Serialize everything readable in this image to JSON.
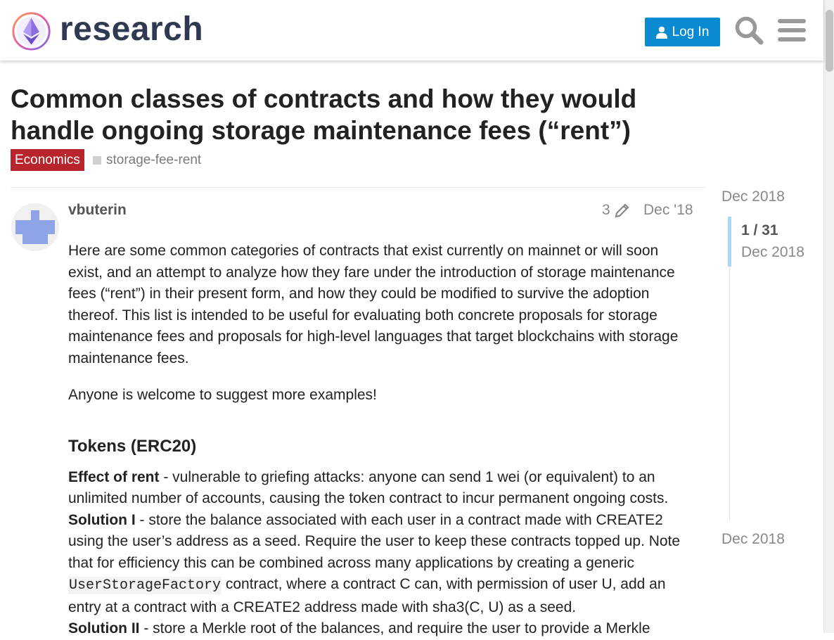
{
  "header": {
    "logo_text": "research",
    "login_label": "Log In",
    "icons": [
      "search-icon",
      "hamburger-menu-icon",
      "user-icon"
    ]
  },
  "topic": {
    "title": "Common classes of contracts and how they would handle ongoing storage maintenance fees (“rent”)",
    "category": "Economics",
    "category_color": "#b8242b",
    "tag": "storage-fee-rent"
  },
  "post": {
    "username": "vbuterin",
    "edit_count": "3",
    "date": "Dec '18",
    "intro": "Here are some common categories of contracts that exist currently on mainnet or will soon exist, and an attempt to analyze how they fare under the introduction of storage maintenance fees (“rent”) in their present form, and how they could be modified to survive the adoption thereof. This list is intended to be useful for evaluating both concrete proposals for storage maintenance fees and proposals for high-level languages that target blockchains with storage maintenance fees.",
    "invite": "Anyone is welcome to suggest more examples!",
    "heading": "Tokens (ERC20)",
    "effect_label": "Effect of rent",
    "effect_text": " - vulnerable to griefing attacks: anyone can send 1 wei (or equivalent) to an unlimited number of accounts, causing the token contract to incur permanent ongoing costs.",
    "solution1_label": "Solution I",
    "solution1_text_a": " - store the balance associated with each user in a contract made with CREATE2 using the user’s address as a seed. Require the user to keep these contracts topped up. Note that for efficiency this can be combined across many applications by creating a generic ",
    "solution1_code": "UserStorageFactory",
    "solution1_text_b": " contract, where a contract C can, with permission of user U, add an entry at a contract with a CREATE2 address made with sha3(C, U) as a seed.",
    "solution2_label": "Solution II",
    "solution2_text": " - store a Merkle root of the balances, and require the user to provide a Merkle"
  },
  "timeline": {
    "start_date": "Dec 2018",
    "position": "1 / 31",
    "position_date": "Dec 2018",
    "end_date": "Dec 2018"
  },
  "colors": {
    "accent": "#0a8ad0",
    "timeline_handle": "#a8d8f5"
  }
}
